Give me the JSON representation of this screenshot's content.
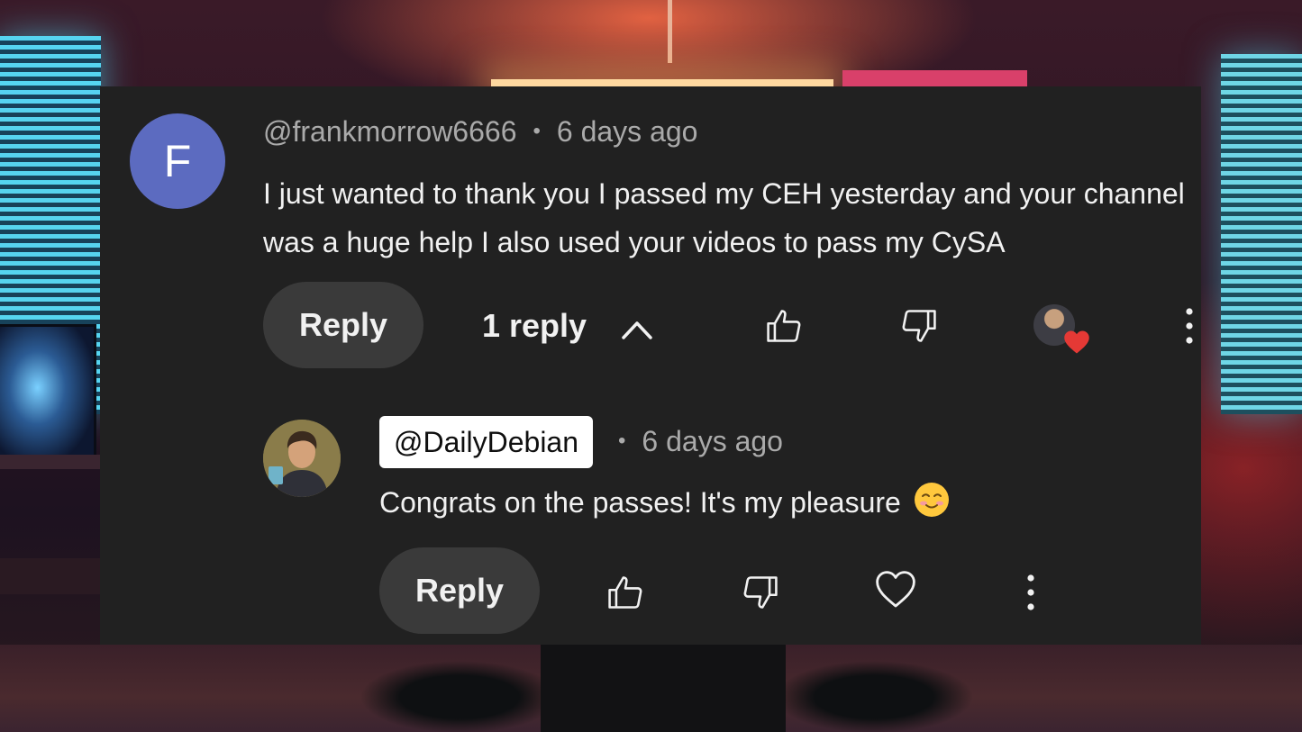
{
  "comment": {
    "avatar_letter": "F",
    "author": "@frankmorrow6666",
    "separator": "•",
    "timestamp": "6 days ago",
    "text": "I just wanted to thank you I passed my CEH yesterday and your channel was a huge help I also used your videos to pass my CySA",
    "reply_label": "Reply",
    "reply_count": "1 reply",
    "avatar_color": "#5c6bc0"
  },
  "reply": {
    "author": "@DailyDebian",
    "separator": "•",
    "timestamp": "6 days ago",
    "text": "Congrats on the passes! It's my pleasure",
    "emoji": "smiling-face-icon",
    "reply_label": "Reply"
  },
  "icons": {
    "expand": "chevron-up-icon",
    "like": "thumbs-up-icon",
    "dislike": "thumbs-down-icon",
    "creator_heart": "creator-heart-badge",
    "heart": "heart-outline-icon",
    "more": "more-vertical-icon"
  },
  "colors": {
    "card_background": "#212121",
    "button_background": "#3a3a3a",
    "heart_red": "#e53935"
  }
}
